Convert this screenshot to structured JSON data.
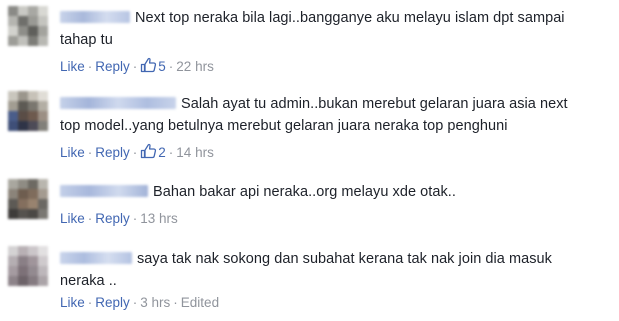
{
  "labels": {
    "like": "Like",
    "reply": "Reply",
    "separator": "·"
  },
  "colors": {
    "link": "#4267b2",
    "meta": "#90949c",
    "text": "#1d2129"
  },
  "comments": [
    {
      "text_line1": "Next top neraka bila lagi..bangganye aku melayu islam dpt sampai",
      "text_line2": "tahap tu",
      "likes": "5",
      "time": "22 hrs",
      "edited": ""
    },
    {
      "text_line1": "Salah ayat tu admin..bukan merebut gelaran juara asia next",
      "text_line2": "top model..yang betulnya merebut gelaran juara neraka top penghuni",
      "likes": "2",
      "time": "14 hrs",
      "edited": ""
    },
    {
      "text_line1": "Bahan bakar api neraka..org melayu xde otak..",
      "text_line2": "",
      "likes": "",
      "time": "13 hrs",
      "edited": ""
    },
    {
      "text_line1": "saya tak nak sokong dan subahat kerana tak nak join dia masuk",
      "text_line2": "neraka ..",
      "likes": "",
      "time": "3 hrs",
      "edited": "Edited"
    }
  ]
}
